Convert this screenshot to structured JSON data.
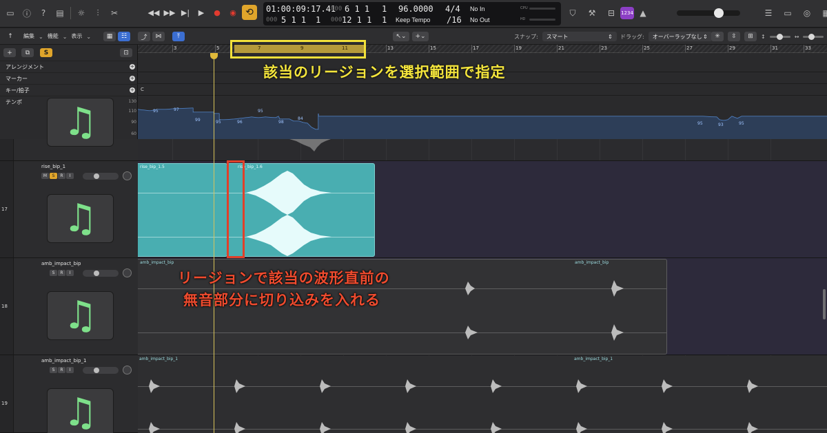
{
  "lcd": {
    "smpte": "01:00:09:17.41",
    "smpte_dim": "000",
    "position_bars": "6  1  1",
    "position_ticks": "1",
    "position_dim": "000",
    "subpos_a": "5  1  1",
    "subpos_a_ticks": "1",
    "subpos_b": "12  1  1",
    "subpos_b_ticks": "1",
    "tempo": "96.0000",
    "tempo_mode": "Keep Tempo",
    "signature": "4/4",
    "division": "/16",
    "midi_in": "No In",
    "midi_out": "No Out",
    "cpu_label": "CPU",
    "hd_label": "HD"
  },
  "control_bar": {
    "count_in_badge": "1234"
  },
  "toolbar": {
    "edit": "編集",
    "functions": "機能",
    "view": "表示",
    "snap_label": "スナップ:",
    "snap_value": "スマート",
    "drag_label": "ドラッグ:",
    "drag_value": "オーバーラップなし"
  },
  "global_tracks": {
    "arrangement": "アレンジメント",
    "marker": "マーカー",
    "key_sig": "キー/拍子",
    "tempo": "テンポ",
    "key_value": "C",
    "tempo_axis": [
      "130",
      "110",
      "90",
      "60"
    ],
    "tempo_points": [
      "95",
      "97",
      "99",
      "95",
      "96",
      "95",
      "98",
      "84",
      "95",
      "93",
      "95"
    ]
  },
  "ruler": {
    "bars": [
      "3",
      "5",
      "7",
      "9",
      "11",
      "13",
      "15",
      "17",
      "19",
      "21",
      "23",
      "25",
      "27",
      "29",
      "31",
      "33"
    ]
  },
  "tracks": [
    {
      "number": "17",
      "name": "rise_bip_1",
      "buttons": [
        "M",
        "S",
        "R",
        "I"
      ],
      "regions": [
        "rise_bip_1.5",
        "rise_bip_1.6"
      ]
    },
    {
      "number": "18",
      "name": "amb_impact_bip",
      "buttons": [
        "S",
        "R",
        "I"
      ],
      "regions": [
        "amb_impact_bip",
        "amb_impact_bip"
      ]
    },
    {
      "number": "19",
      "name": "amb_impact_bip_1",
      "buttons": [
        "S",
        "R",
        "I"
      ],
      "regions": [
        "amb_impact_bip_1",
        "amb_impact_bip_1"
      ]
    }
  ],
  "annotations": {
    "yellow": "該当のリージョンを選択範囲で指定",
    "red_line1": "リージョンで該当の波形直前の",
    "red_line2": "無音部分に切り込みを入れる"
  },
  "colors": {
    "cycle_button": "#e0a52b",
    "region_teal": "#49aeb1",
    "annotation_yellow": "#f4e53c",
    "annotation_red": "#ef4b2e",
    "track_icon_note": "#7ee08a",
    "count_in_badge": "#8c3fc5"
  }
}
